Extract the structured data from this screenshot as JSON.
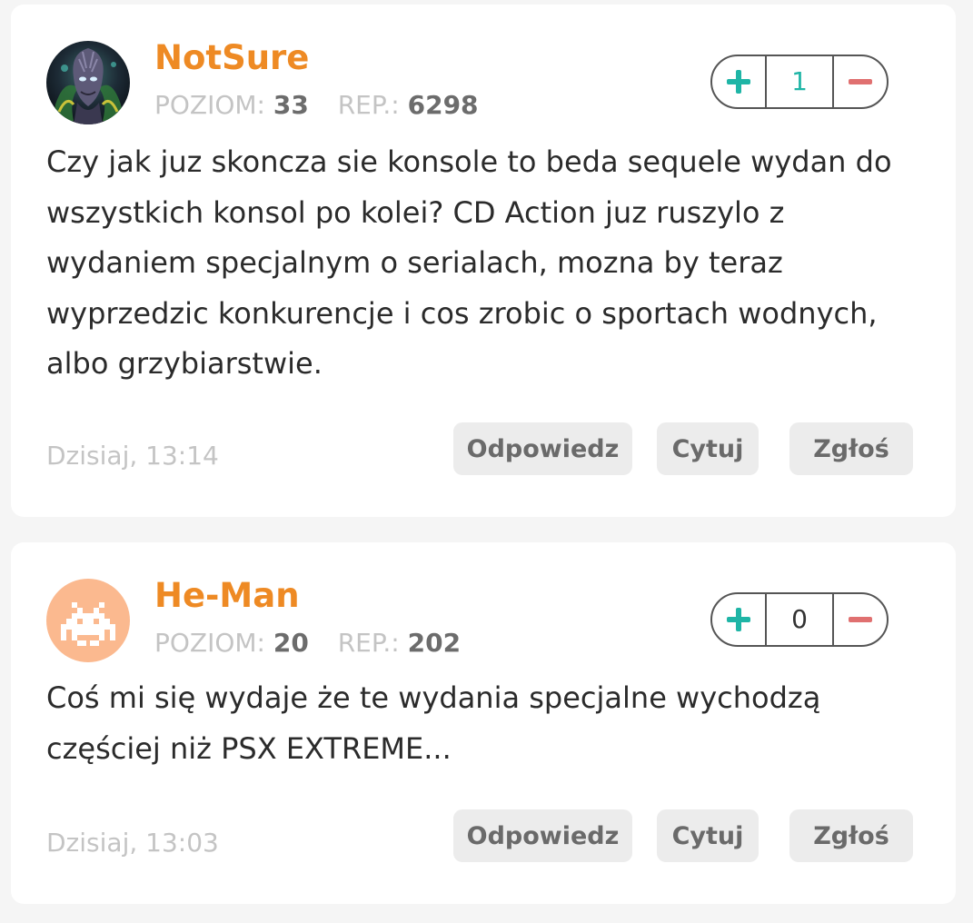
{
  "comments": [
    {
      "username": "NotSure",
      "level_label": "POZIOM:",
      "level": "33",
      "rep_label": "REP.:",
      "rep": "6298",
      "votes": "1",
      "text": "Czy jak juz skoncza sie konsole to beda sequele wydan do wszystkich konsol po kolei? CD Action juz ruszylo z wydaniem specjalnym o serialach, mozna by teraz wyprzedzic konkurencje i cos zrobic o sportach wodnych, albo grzybiarstwie.",
      "timestamp": "Dzisiaj, 13:14",
      "reply_label": "Odpowiedz",
      "quote_label": "Cytuj",
      "report_label": "Zgłoś",
      "avatar": "alien-portrait-avatar",
      "vote_count_color": "#1fb5a6"
    },
    {
      "username": "He-Man",
      "level_label": "POZIOM:",
      "level": "20",
      "rep_label": "REP.:",
      "rep": "202",
      "votes": "0",
      "text": "Coś mi się wydaje że te wydania specjalne wychodzą częściej niż PSX EXTREME...",
      "timestamp": "Dzisiaj, 13:03",
      "reply_label": "Odpowiedz",
      "quote_label": "Cytuj",
      "report_label": "Zgłoś",
      "avatar": "space-invader-avatar",
      "vote_count_color": "#333333"
    }
  ],
  "colors": {
    "username": "#ee8a24",
    "upvote": "#1fb5a6",
    "downvote": "#e07070",
    "avatar_placeholder_bg": "#fbb98f"
  },
  "icons": {
    "upvote": "plus-icon",
    "downvote": "minus-icon"
  }
}
